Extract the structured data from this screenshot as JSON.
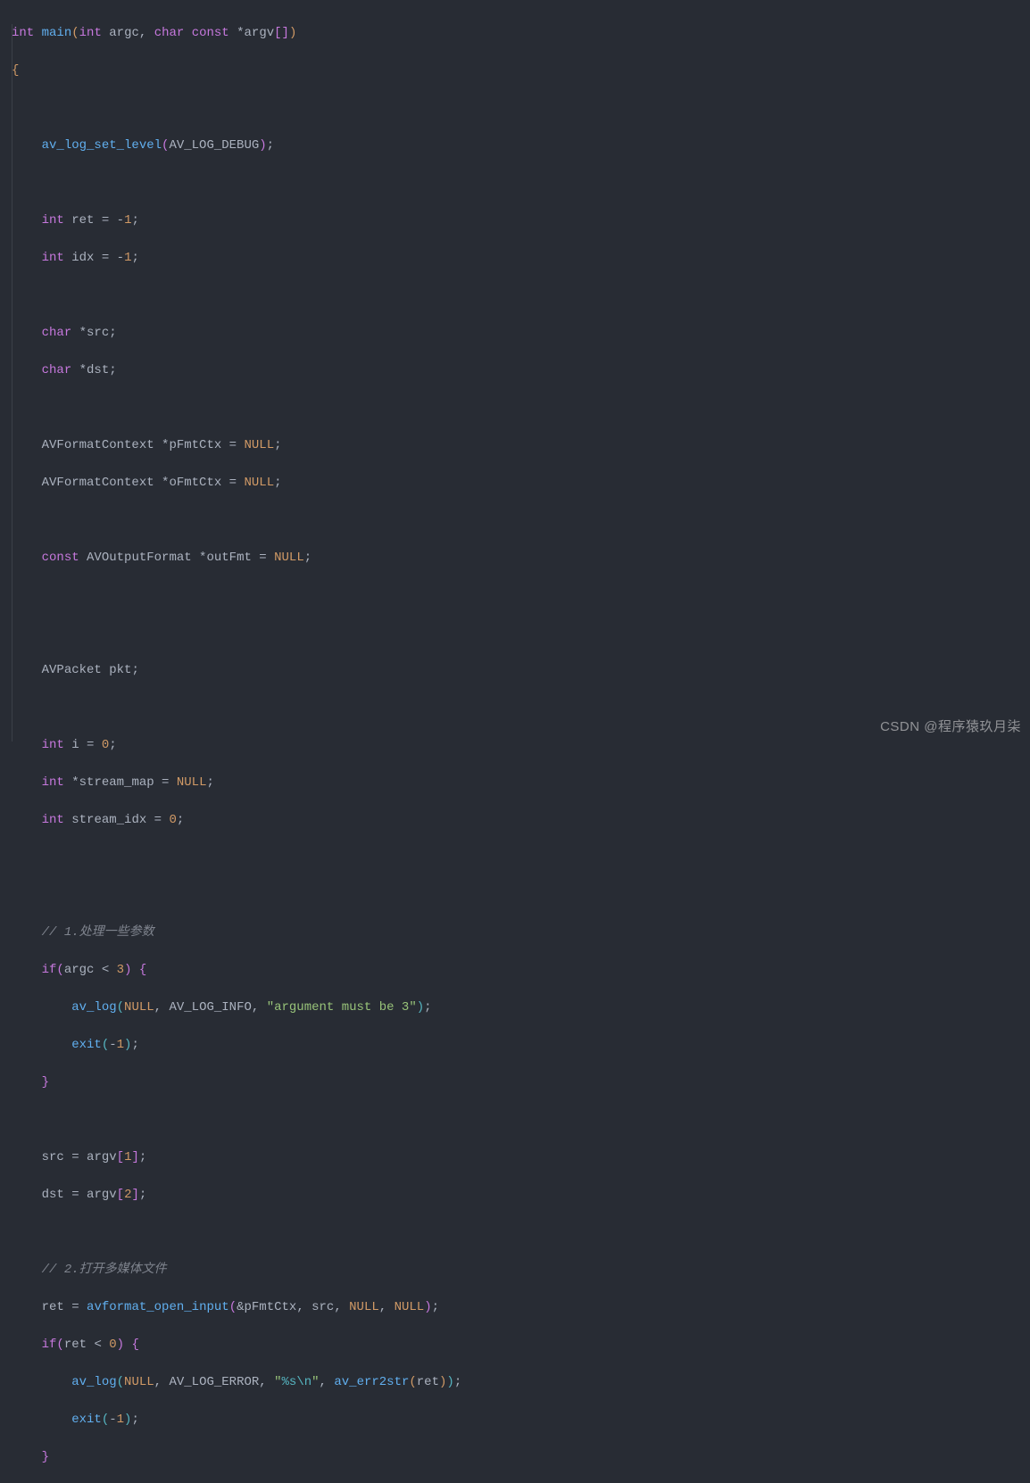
{
  "watermark": "CSDN @程序猿玖月柒",
  "code": {
    "l1": {
      "t1": "int",
      "t2": "main",
      "t3": "int",
      "t4": "argc",
      "t5": "char",
      "t6": "const",
      "t7": "argv"
    },
    "l2": {
      "t1": "{"
    },
    "l4": {
      "t1": "av_log_set_level",
      "t2": "AV_LOG_DEBUG"
    },
    "l6": {
      "t1": "int",
      "t2": "ret",
      "t3": "-",
      "t4": "1"
    },
    "l7": {
      "t1": "int",
      "t2": "idx",
      "t3": "-",
      "t4": "1"
    },
    "l9": {
      "t1": "char",
      "t2": "src"
    },
    "l10": {
      "t1": "char",
      "t2": "dst"
    },
    "l12": {
      "t1": "AVFormatContext",
      "t2": "pFmtCtx",
      "t3": "NULL"
    },
    "l13": {
      "t1": "AVFormatContext",
      "t2": "oFmtCtx",
      "t3": "NULL"
    },
    "l15": {
      "t1": "const",
      "t2": "AVOutputFormat",
      "t3": "outFmt",
      "t4": "NULL"
    },
    "l18": {
      "t1": "AVPacket",
      "t2": "pkt"
    },
    "l20": {
      "t1": "int",
      "t2": "i",
      "t3": "0"
    },
    "l21": {
      "t1": "int",
      "t2": "stream_map",
      "t3": "NULL"
    },
    "l22": {
      "t1": "int",
      "t2": "stream_idx",
      "t3": "0"
    },
    "l25": {
      "t1": "// 1.处理一些参数"
    },
    "l26": {
      "t1": "if",
      "t2": "argc",
      "t3": "3"
    },
    "l27": {
      "t1": "av_log",
      "t2": "NULL",
      "t3": "AV_LOG_INFO",
      "t4": "\"argument must be 3\""
    },
    "l28": {
      "t1": "exit",
      "t2": "-",
      "t3": "1"
    },
    "l31": {
      "t1": "src",
      "t2": "argv",
      "t3": "1"
    },
    "l32": {
      "t1": "dst",
      "t2": "argv",
      "t3": "2"
    },
    "l34": {
      "t1": "// 2.打开多媒体文件"
    },
    "l35": {
      "t1": "ret",
      "t2": "avformat_open_input",
      "t3": "pFmtCtx",
      "t4": "src",
      "t5": "NULL",
      "t6": "NULL"
    },
    "l36": {
      "t1": "if",
      "t2": "ret",
      "t3": "0"
    },
    "l37": {
      "t1": "av_log",
      "t2": "NULL",
      "t3": "AV_LOG_ERROR",
      "t4": "\"",
      "t5": "%s",
      "t6": "\\n",
      "t7": "\"",
      "t8": "av_err2str",
      "t9": "ret"
    },
    "l38": {
      "t1": "exit",
      "t2": "-",
      "t3": "1"
    },
    "l39": {
      "t1": "}"
    }
  }
}
